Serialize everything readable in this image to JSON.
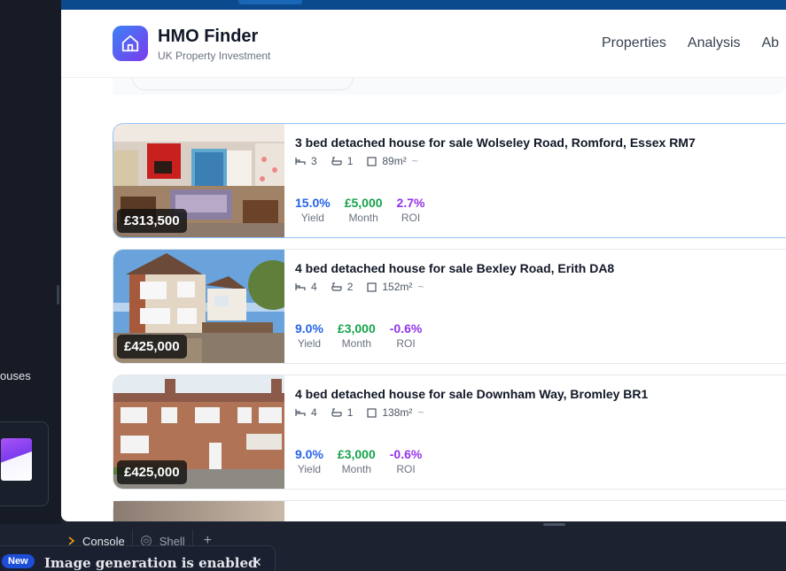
{
  "app": {
    "name": "HMO Finder",
    "tagline": "UK Property Investment"
  },
  "nav": {
    "items": [
      "Properties",
      "Analysis",
      "Ab"
    ]
  },
  "listings": [
    {
      "title": "3 bed detached house for sale Wolseley Road, Romford, Essex RM7",
      "beds": "3",
      "baths": "1",
      "area": "89m²",
      "approx": "~",
      "price": "£313,500",
      "yield": "15.0%",
      "month": "£5,000",
      "roi": "2.7%"
    },
    {
      "title": "4 bed detached house for sale Bexley Road, Erith DA8",
      "beds": "4",
      "baths": "2",
      "area": "152m²",
      "approx": "~",
      "price": "£425,000",
      "yield": "9.0%",
      "month": "£3,000",
      "roi": "-0.6%"
    },
    {
      "title": "4 bed detached house for sale Downham Way, Bromley BR1",
      "beds": "4",
      "baths": "1",
      "area": "138m²",
      "approx": "~",
      "price": "£425,000",
      "yield": "9.0%",
      "month": "£3,000",
      "roi": "-0.6%"
    }
  ],
  "metric_labels": {
    "yield": "Yield",
    "month": "Month",
    "roi": "ROI"
  },
  "ide": {
    "sidebar_partial_text": "ouses",
    "tabs": [
      "Console",
      "Shell"
    ],
    "add_tab": "+",
    "toast_badge": "New",
    "toast_message": "Image generation is enabled",
    "toast_close": "✕"
  },
  "colors": {
    "yield": "#2563eb",
    "month": "#16a34a",
    "roi": "#9333ea",
    "logo_gradient_start": "#3b82f6",
    "logo_gradient_end": "#7c3aed",
    "topbar": "#0b4a8c"
  },
  "icons": {
    "logo": "home-icon",
    "beds": "bed-icon",
    "baths": "bath-icon",
    "area": "square-icon",
    "console": "chevron-right-icon",
    "shell": "shell-icon",
    "close": "close-icon"
  }
}
